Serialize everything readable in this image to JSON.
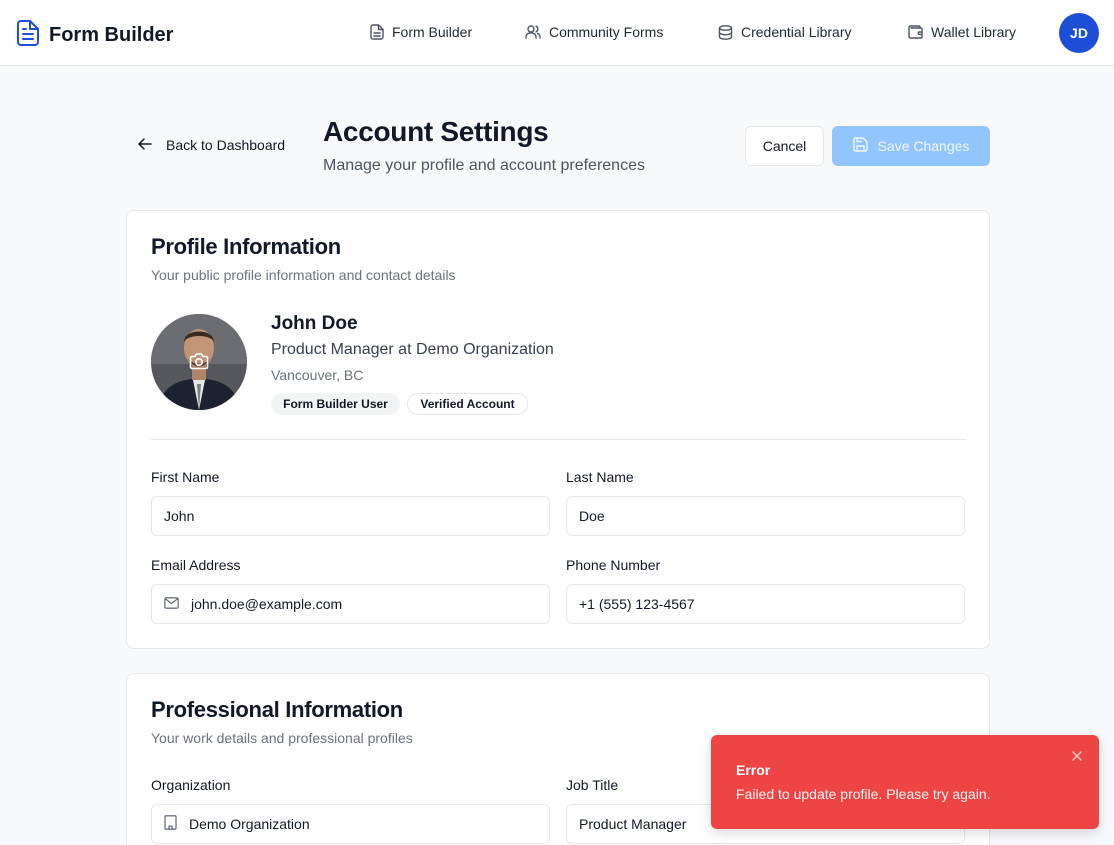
{
  "brand": {
    "title": "Form Builder",
    "icon": "file-text-icon"
  },
  "nav": {
    "items": [
      {
        "label": "Form Builder",
        "icon": "file-text-icon"
      },
      {
        "label": "Community Forms",
        "icon": "users-icon"
      },
      {
        "label": "Credential Library",
        "icon": "database-icon"
      },
      {
        "label": "Wallet Library",
        "icon": "wallet-icon"
      }
    ],
    "avatar_initials": "JD"
  },
  "header": {
    "back_label": "Back to Dashboard",
    "title": "Account Settings",
    "subtitle": "Manage your profile and account preferences",
    "cancel_label": "Cancel",
    "save_label": "Save Changes"
  },
  "profile": {
    "card_title": "Profile Information",
    "card_subtitle": "Your public profile information and contact details",
    "name": "John Doe",
    "role": "Product Manager at Demo Organization",
    "location": "Vancouver, BC",
    "badges": [
      "Form Builder User",
      "Verified Account"
    ],
    "fields": {
      "first_name": {
        "label": "First Name",
        "value": "John"
      },
      "last_name": {
        "label": "Last Name",
        "value": "Doe"
      },
      "email": {
        "label": "Email Address",
        "value": "john.doe@example.com"
      },
      "phone": {
        "label": "Phone Number",
        "value": "+1 (555) 123-4567"
      }
    }
  },
  "professional": {
    "card_title": "Professional Information",
    "card_subtitle": "Your work details and professional profiles",
    "fields": {
      "organization": {
        "label": "Organization",
        "value": "Demo Organization"
      },
      "job_title": {
        "label": "Job Title",
        "value": "Product Manager"
      }
    }
  },
  "toast": {
    "title": "Error",
    "message": "Failed to update profile. Please try again."
  },
  "colors": {
    "accent": "#1d4ed8",
    "save_disabled": "#93c5fd",
    "error": "#ef4444"
  }
}
